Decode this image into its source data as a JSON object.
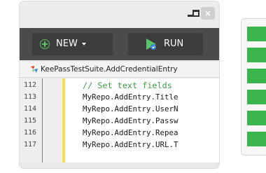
{
  "toolbar": {
    "new_label": "NEW",
    "run_label": "RUN"
  },
  "breadcrumb": {
    "text": "KeePassTestSuite.AddCredentialEntry"
  },
  "window_controls": {
    "close_glyph": "×"
  },
  "editor": {
    "lines": [
      {
        "num": "112",
        "code": "// Set text fields"
      },
      {
        "num": "113",
        "code": "MyRepo.AddEntry.Title"
      },
      {
        "num": "114",
        "code": "MyRepo.AddEntry.UserN"
      },
      {
        "num": "115",
        "code": "MyRepo.AddEntry.Passw"
      },
      {
        "num": "116",
        "code": "MyRepo.AddEntry.Repea"
      },
      {
        "num": "117",
        "code": "MyRepo.AddEntry.URL.T"
      }
    ]
  },
  "colors": {
    "accent_green": "#3ab54b",
    "toolbar_dark": "#4b4b4b",
    "comment_green": "#3c9e47",
    "marker_yellow": "#f5e04a"
  },
  "panel": {
    "block_count": 6
  }
}
